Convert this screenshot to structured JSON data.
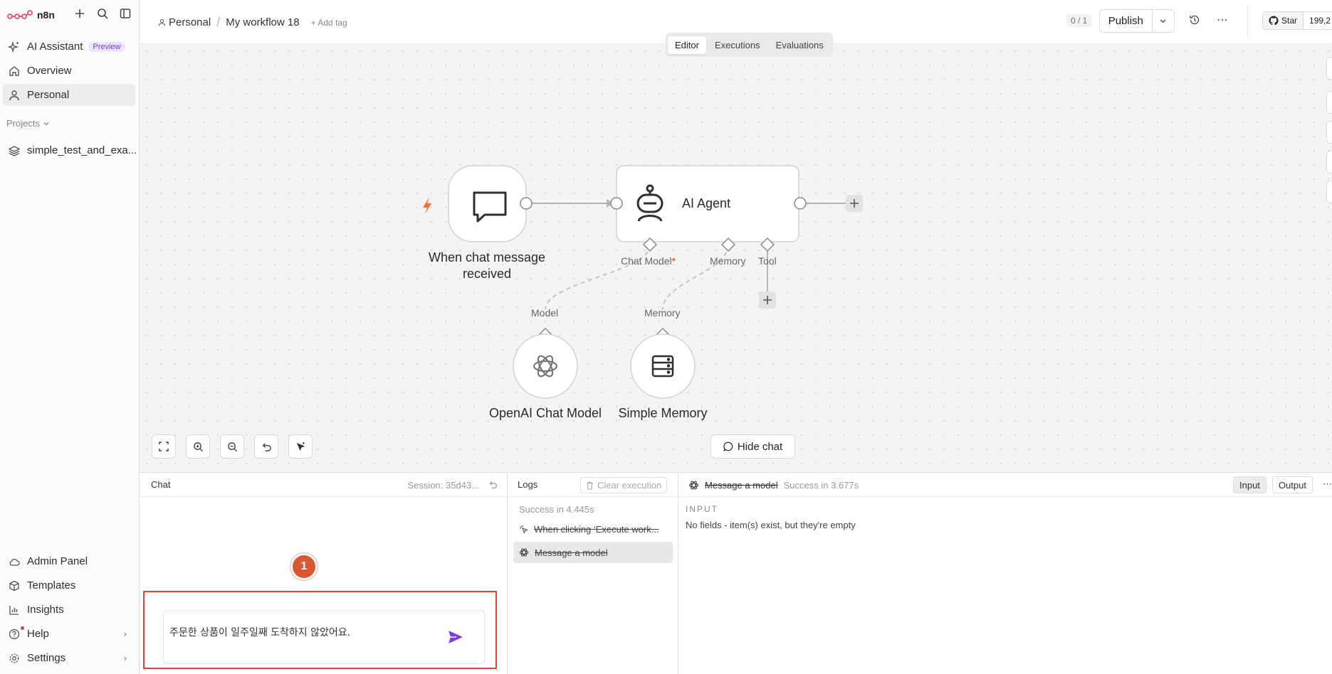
{
  "brand": {
    "name": "n8n"
  },
  "sidebar": {
    "items": [
      {
        "label": "AI Assistant",
        "badge": "Preview"
      },
      {
        "label": "Overview"
      },
      {
        "label": "Personal"
      }
    ],
    "projects_label": "Projects",
    "project_item": "simple_test_and_exa...",
    "bottom_items": [
      {
        "label": "Admin Panel"
      },
      {
        "label": "Templates"
      },
      {
        "label": "Insights"
      },
      {
        "label": "Help"
      },
      {
        "label": "Settings"
      }
    ]
  },
  "header": {
    "breadcrumb_project": "Personal",
    "workflow_name": "My workflow 18",
    "add_tag": "+ Add tag",
    "counter": "0 / 1",
    "publish_label": "Publish",
    "github_star": "Star",
    "github_count": "199,2"
  },
  "tabs": [
    {
      "label": "Editor",
      "active": true
    },
    {
      "label": "Executions",
      "active": false
    },
    {
      "label": "Evaluations",
      "active": false
    }
  ],
  "canvas": {
    "trigger_node": {
      "label_line1": "When chat message",
      "label_line2": "received"
    },
    "agent_node": {
      "label": "AI Agent"
    },
    "ports": {
      "chat_model": "Chat Model",
      "required_mark": "*",
      "memory": "Memory",
      "tool": "Tool"
    },
    "model_node": {
      "port": "Model",
      "label": "OpenAI Chat Model"
    },
    "memory_node": {
      "port": "Memory",
      "label": "Simple Memory"
    },
    "hide_chat": "Hide chat"
  },
  "chat": {
    "title": "Chat",
    "session": "Session: 35d43...",
    "step_number": "1",
    "input_value": "주문한 상품이 일주일째 도착하지 않았어요."
  },
  "logs": {
    "title": "Logs",
    "clear": "Clear execution",
    "success": "Success in 4.445s",
    "items": [
      {
        "label": "When clicking ‘Execute work...",
        "selected": false
      },
      {
        "label": "Message a model",
        "selected": true
      }
    ]
  },
  "detail": {
    "node_name": "Message a model",
    "status": "Success in 3.677s",
    "input_btn": "Input",
    "output_btn": "Output",
    "input_title": "INPUT",
    "input_msg": "No fields - item(s) exist, but they're empty"
  },
  "colors": {
    "accent": "#7c3aed",
    "highlight": "#e0442e",
    "badge": "#d9572f",
    "trigger": "#ff6d2d"
  }
}
